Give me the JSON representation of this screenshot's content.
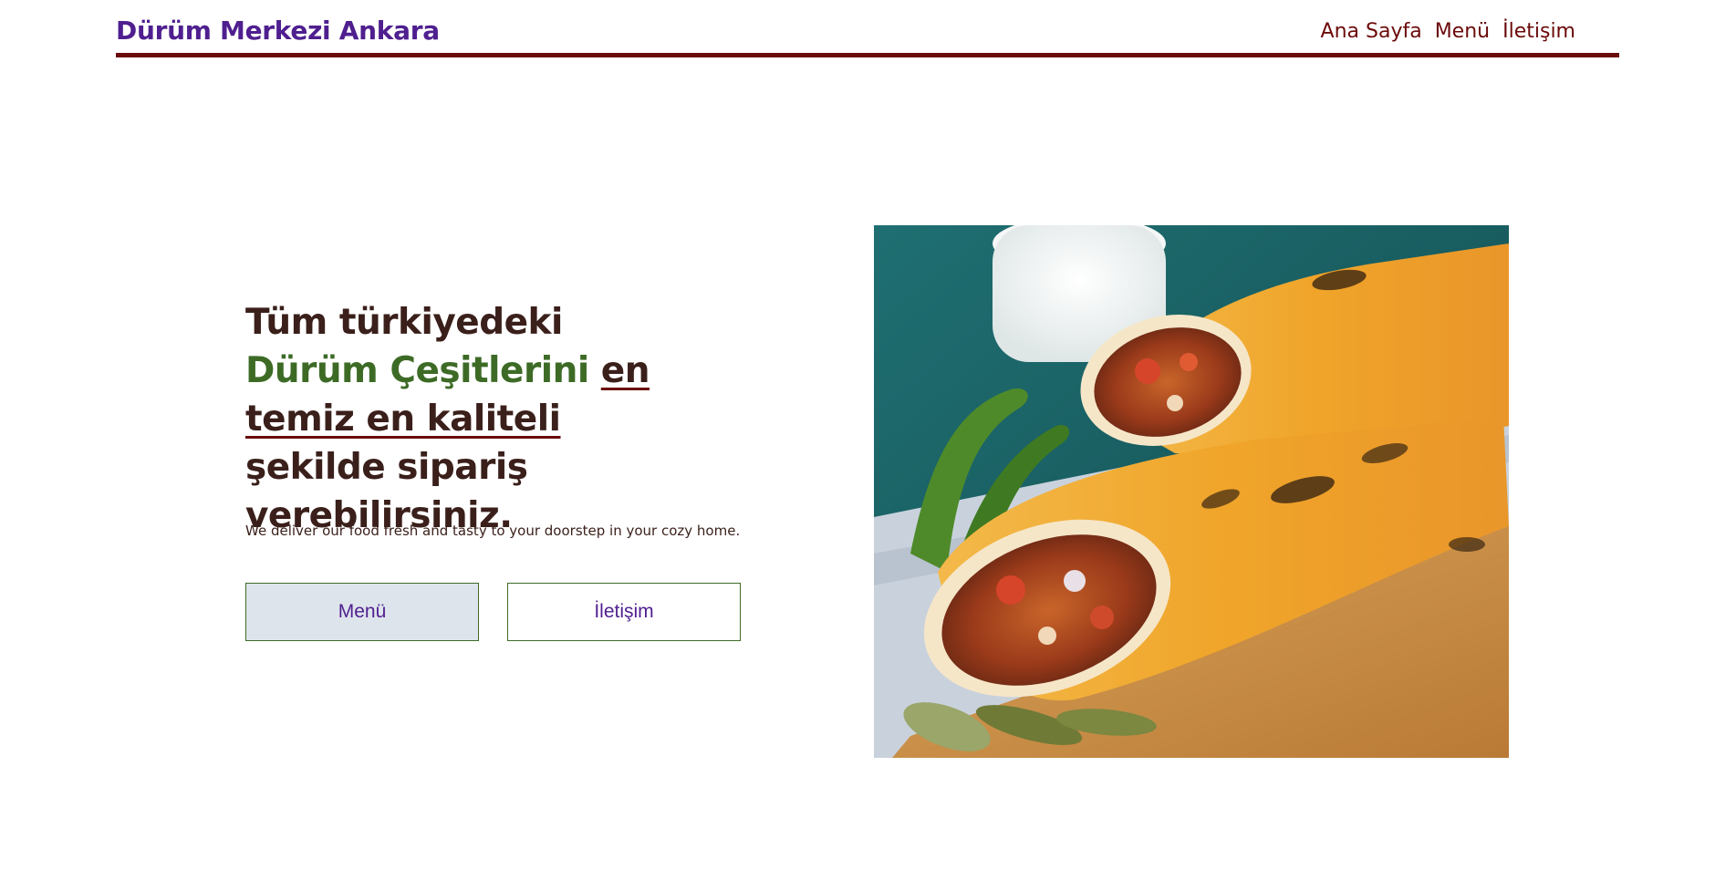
{
  "header": {
    "brand": "Dürüm Merkezi Ankara",
    "nav": [
      {
        "label": "Ana Sayfa"
      },
      {
        "label": "Menü"
      },
      {
        "label": "İletişim"
      }
    ]
  },
  "hero": {
    "title": {
      "part1": "Tüm türkiyedeki ",
      "accent": "Dürüm Çeşitlerini",
      "space1": " ",
      "emphasis": "en temiz en kaliteli ",
      "part2": "şekilde sipariş verebilirsiniz."
    },
    "subtitle": "We deliver our food fresh and tasty to your doorstep in your cozy home.",
    "buttons": {
      "menu": "Menü",
      "contact": "İletişim"
    },
    "image_icon": "durum-wrap-photo"
  },
  "colors": {
    "brand": "#4f1f8f",
    "nav_and_rule": "#6b0a0a",
    "accent_green": "#3d6b26",
    "text_dark": "#3a1f1a",
    "menu_button_bg": "#dee4ec"
  }
}
